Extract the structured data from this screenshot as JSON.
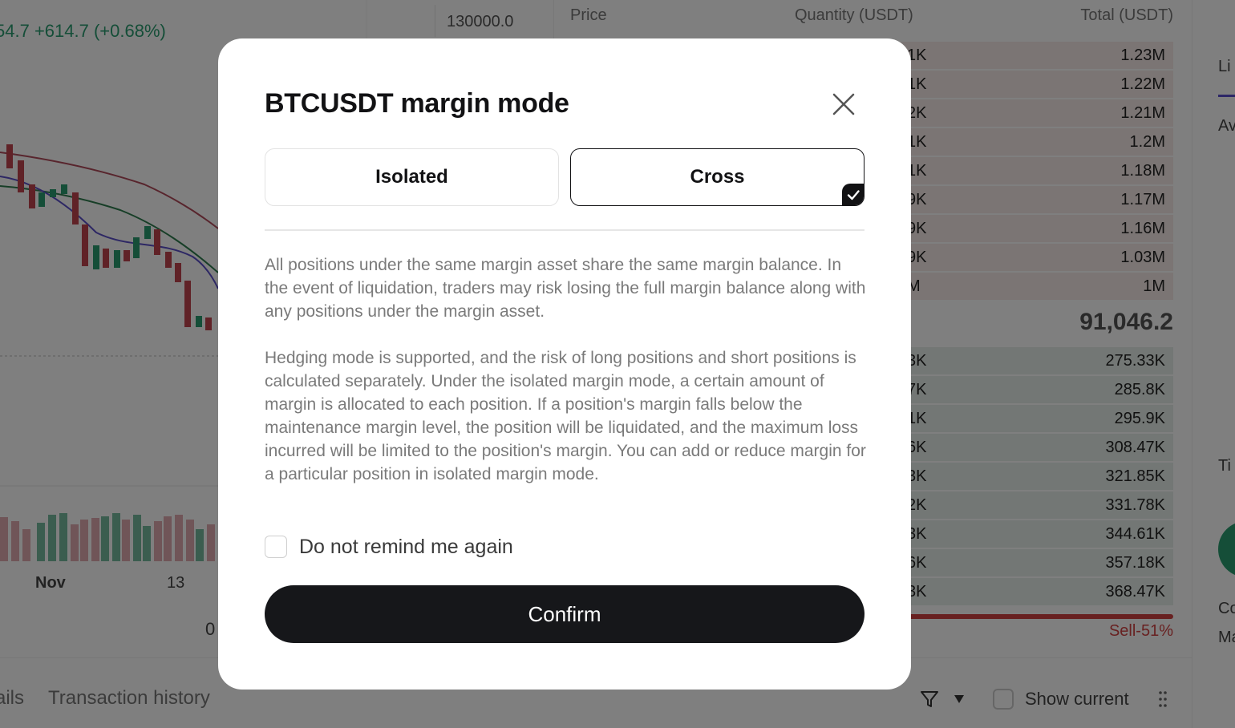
{
  "background": {
    "price_change": {
      "lead": "54.7",
      "change": "+614.7 (+0.68%)"
    },
    "axis_top_value": "130000.0",
    "x_axis": {
      "nov": "Nov",
      "d13": "13",
      "zero": "0"
    },
    "orderbook": {
      "headers": {
        "price": "Price",
        "quantity": "Quantity (USDT)",
        "total": "Total (USDT)"
      },
      "asks": [
        {
          "q": "1K",
          "t": "1.23M"
        },
        {
          "q": "1K",
          "t": "1.22M"
        },
        {
          "q": "2K",
          "t": "1.21M"
        },
        {
          "q": "1K",
          "t": "1.2M"
        },
        {
          "q": "1K",
          "t": "1.18M"
        },
        {
          "q": "9K",
          "t": "1.17M"
        },
        {
          "q": "9K",
          "t": "1.16M"
        },
        {
          "q": "9K",
          "t": "1.03M"
        },
        {
          "q": "M",
          "t": "1M"
        }
      ],
      "mid_price": "91,046.2",
      "bids": [
        {
          "q": "3K",
          "t": "275.33K"
        },
        {
          "q": "7K",
          "t": "285.8K"
        },
        {
          "q": "1K",
          "t": "295.9K"
        },
        {
          "q": "6K",
          "t": "308.47K"
        },
        {
          "q": "3K",
          "t": "321.85K"
        },
        {
          "q": "2K",
          "t": "331.78K"
        },
        {
          "q": "3K",
          "t": "344.61K"
        },
        {
          "q": "6K",
          "t": "357.18K"
        },
        {
          "q": "3K",
          "t": "368.47K"
        }
      ],
      "sell_ratio": "Sell-51%"
    },
    "right_panel": {
      "tab": "Li",
      "av": "Av",
      "ti": "Ti",
      "co": "Co",
      "ma": "Ma"
    },
    "bottom": {
      "details_tab": "ails",
      "transaction_tab": "Transaction history",
      "show_current": "Show current"
    }
  },
  "modal": {
    "title": "BTCUSDT margin mode",
    "modes": {
      "isolated": "Isolated",
      "cross": "Cross",
      "selected": "Cross"
    },
    "description_1": "All positions under the same margin asset share the same margin balance. In the event of liquidation, traders may risk losing the full margin balance along with any positions under the margin asset.",
    "description_2": "Hedging mode is supported, and the risk of long positions and short positions is calculated separately. Under the isolated margin mode, a certain amount of margin is allocated to each position. If a position's margin falls below the maintenance margin level, the position will be liquidated, and the maximum loss incurred will be limited to the position's margin. You can add or reduce margin for a particular position in isolated margin mode.",
    "remind_label": "Do not remind me again",
    "remind_checked": false,
    "confirm_label": "Confirm"
  },
  "colors": {
    "overlay": "#00000080",
    "confirm_bg": "#16171a",
    "up_green": "#2a9d70",
    "down_red": "#d14343"
  }
}
